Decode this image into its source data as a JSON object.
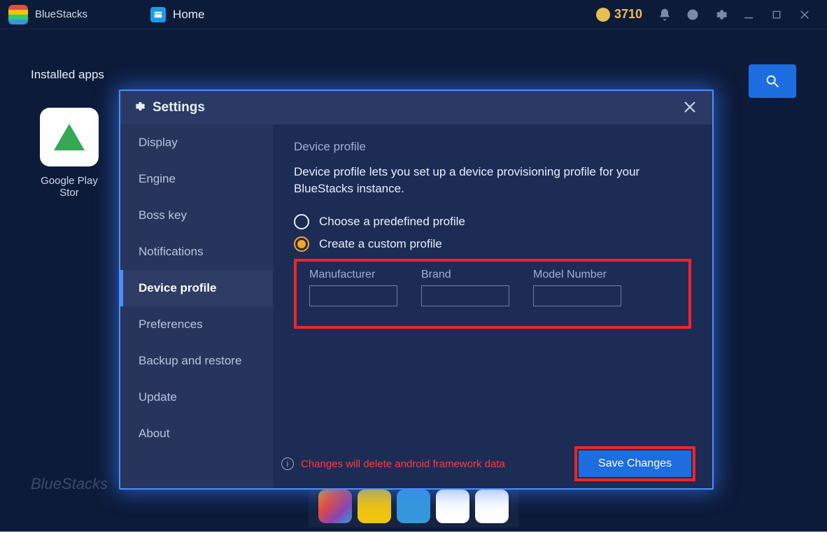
{
  "titlebar": {
    "app_name": "BlueStacks",
    "tab_home": "Home",
    "coins": "3710"
  },
  "main": {
    "installed": "Installed apps",
    "play_store": "Google Play Stor",
    "watermark": "BlueStacks"
  },
  "modal": {
    "title": "Settings",
    "sidebar": {
      "items": [
        {
          "label": "Display"
        },
        {
          "label": "Engine"
        },
        {
          "label": "Boss key"
        },
        {
          "label": "Notifications"
        },
        {
          "label": "Device profile"
        },
        {
          "label": "Preferences"
        },
        {
          "label": "Backup and restore"
        },
        {
          "label": "Update"
        },
        {
          "label": "About"
        }
      ],
      "active": 4
    },
    "content": {
      "section_title": "Device profile",
      "description": "Device profile lets you set up a device provisioning profile for your BlueStacks instance.",
      "radio1": "Choose a predefined profile",
      "radio2": "Create a custom profile",
      "fields": {
        "manufacturer": {
          "label": "Manufacturer",
          "value": ""
        },
        "brand": {
          "label": "Brand",
          "value": ""
        },
        "model": {
          "label": "Model Number",
          "value": ""
        }
      },
      "warning": "Changes will delete android framework data",
      "save": "Save Changes"
    }
  }
}
